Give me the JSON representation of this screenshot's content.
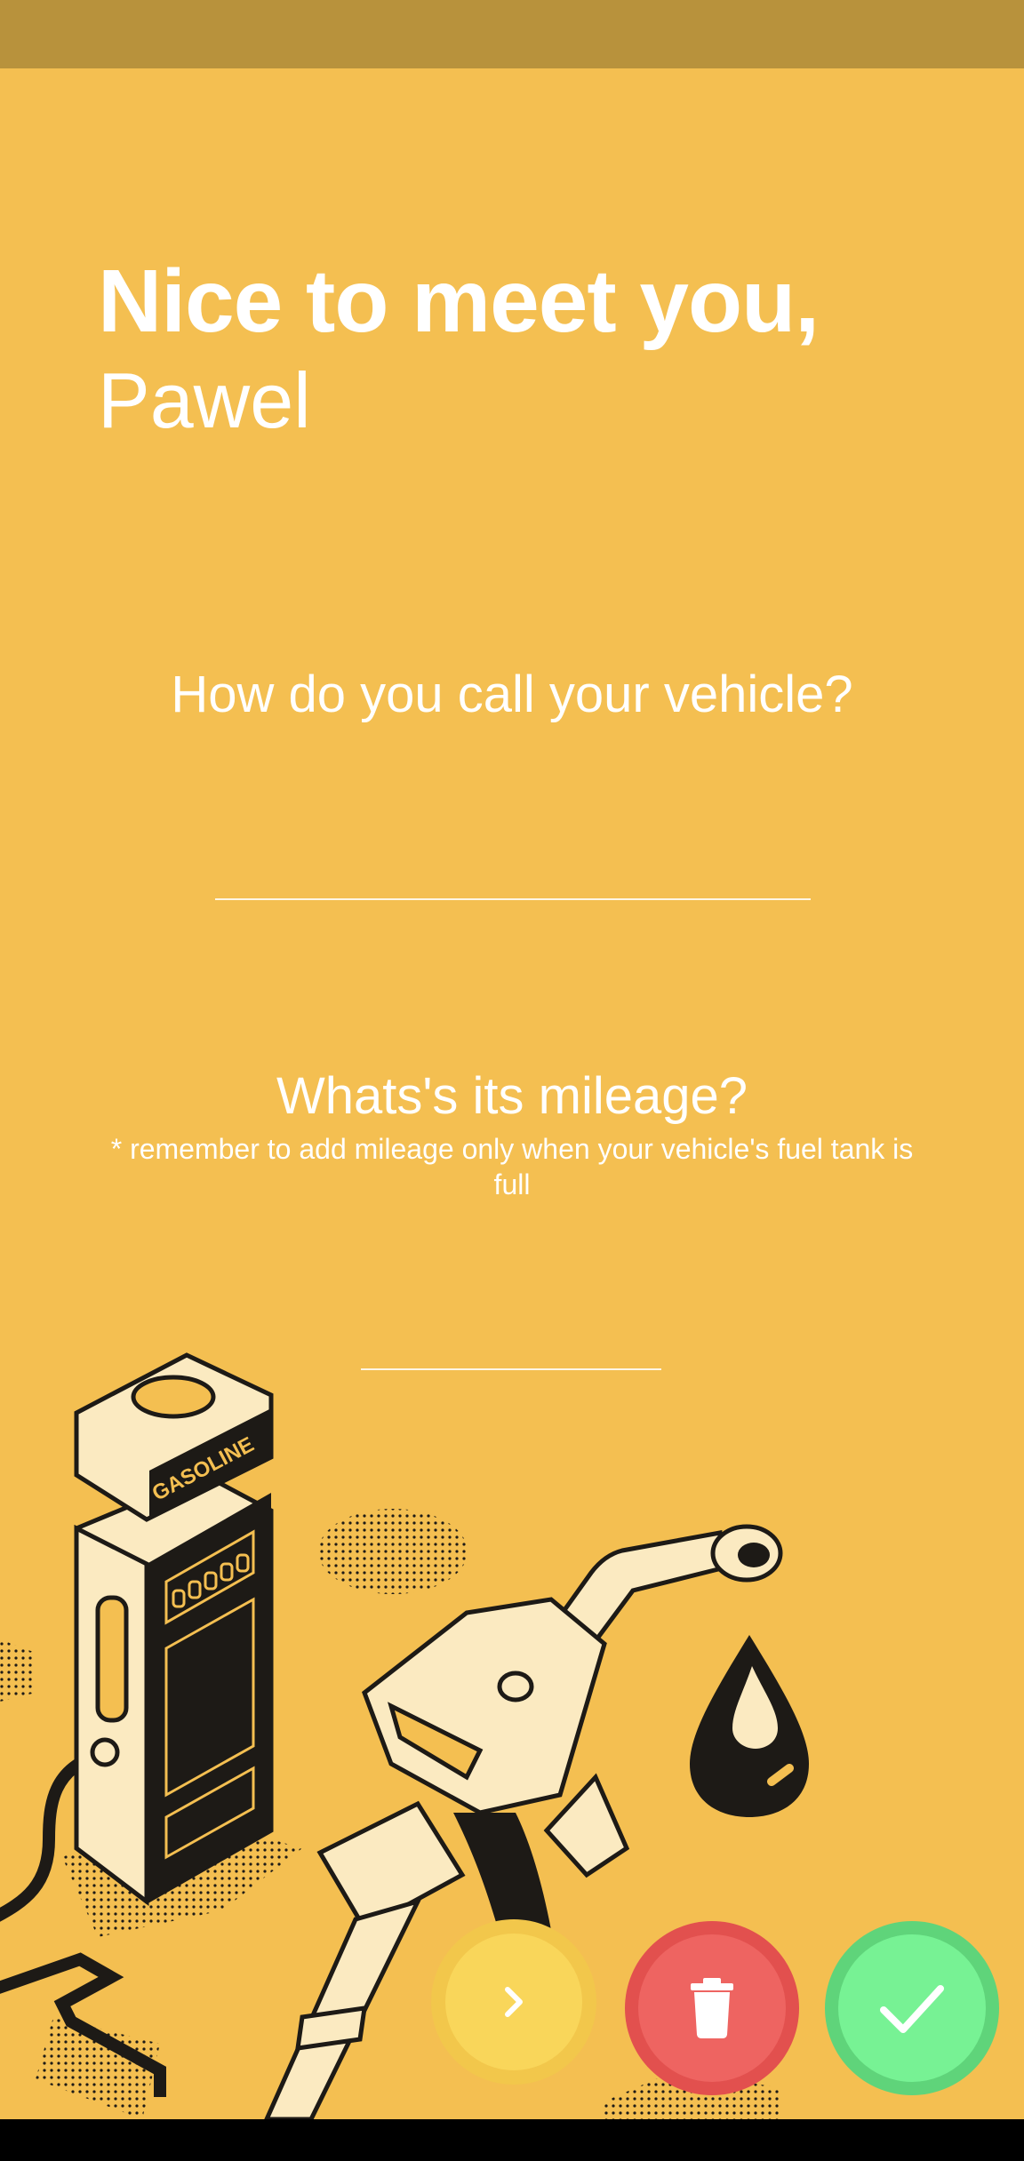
{
  "greeting": {
    "title": "Nice to meet you,",
    "name": "Pawel"
  },
  "vehicle_name": {
    "question": "How do you call your vehicle?",
    "value": ""
  },
  "mileage": {
    "question": "Whats's its mileage?",
    "hint": "* remember to add mileage only when your vehicle's fuel tank is full",
    "value": ""
  },
  "illustration": {
    "pump_label": "GASOLINE"
  },
  "actions": {
    "next_icon": "chevron-right-icon",
    "delete_icon": "trash-icon",
    "confirm_icon": "check-icon"
  },
  "colors": {
    "background": "#F4BF51",
    "status_bar": "#B8923C",
    "next_button": "#F9D65A",
    "delete_button": "#EE6461",
    "confirm_button": "#77F294"
  }
}
